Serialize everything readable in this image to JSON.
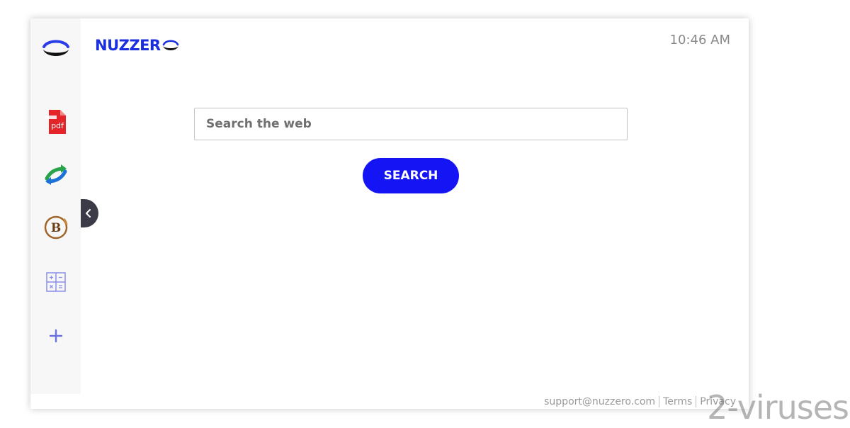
{
  "sidebar": {
    "items": [
      {
        "icon": "brand-logo-icon"
      },
      {
        "icon": "pdf-icon",
        "label": "pdf"
      },
      {
        "icon": "converter-arrows-icon"
      },
      {
        "icon": "bitcoin-icon",
        "label": "B"
      },
      {
        "icon": "calculator-icon"
      },
      {
        "icon": "plus-icon",
        "label": "+"
      }
    ],
    "collapse_icon": "chevron-left-icon"
  },
  "header": {
    "brand": "NUZZER",
    "time": "10:46 AM"
  },
  "search": {
    "placeholder": "Search the web",
    "button_label": "SEARCH"
  },
  "footer": {
    "email": "support@nuzzero.com",
    "terms": "Terms",
    "privacy": "Privacy"
  },
  "watermark": "2-viruses",
  "colors": {
    "brand": "#1a2fe0",
    "button": "#1414f5",
    "sidebar_bg": "#f7f7f8"
  }
}
